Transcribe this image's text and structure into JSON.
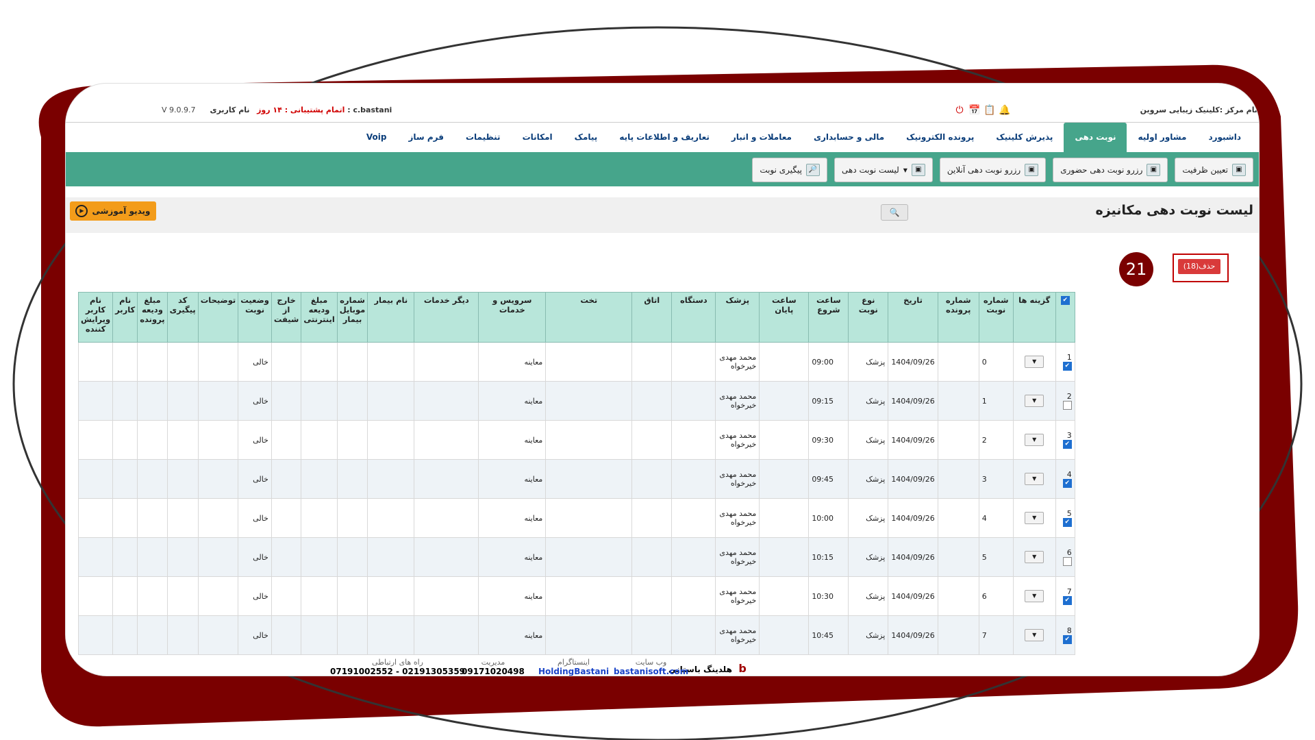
{
  "header": {
    "center_name": "نام مرکز :کلینیک زیبایی سروین",
    "user_label": "نام کاربری : c.bastani",
    "support_label": "اتمام پشتیبانی : ۱۴ روز",
    "version": "V 9.0.9.7"
  },
  "main_nav": {
    "items": [
      {
        "label": "داشبورد"
      },
      {
        "label": "مشاور اولیه"
      },
      {
        "label": "نوبت دهی"
      },
      {
        "label": "پذیرش کلینیک"
      },
      {
        "label": "پرونده الکترونیک"
      },
      {
        "label": "مالی و حسابداری"
      },
      {
        "label": "معاملات و انبار"
      },
      {
        "label": "تعاریف و اطلاعات پایه"
      },
      {
        "label": "پیامک"
      },
      {
        "label": "امکانات"
      },
      {
        "label": "تنظیمات"
      },
      {
        "label": "فرم ساز"
      },
      {
        "label": "Voip"
      }
    ],
    "active_index": 2
  },
  "sub_nav": {
    "items": [
      {
        "label": "تعیین ظرفیت"
      },
      {
        "label": "رزرو نوبت دهی حضوری"
      },
      {
        "label": "رزرو نوبت دهی آنلاین"
      },
      {
        "label": "لیست نوبت دهی"
      },
      {
        "label": "پیگیری نوبت"
      }
    ]
  },
  "page": {
    "title": "لیست نوبت دهی مکانیزه",
    "video_label": "ویدیو آموزشی",
    "badge": "21",
    "delete_label": "حذف(18)"
  },
  "table": {
    "headers": [
      "",
      "گزینه ها",
      "شماره نوبت",
      "شماره پرونده",
      "تاریخ",
      "نوع نوبت",
      "ساعت شروع",
      "ساعت پایان",
      "پزشک",
      "دستگاه",
      "اتاق",
      "تخت",
      "سرویس و خدمات",
      "دیگر خدمات",
      "نام بیمار",
      "شماره موبایل بیمار",
      "مبلغ ودیعه اینترنتی",
      "خارج از شیفت",
      "وضعیت نوبت",
      "توضیحات",
      "کد پیگیری",
      "مبلغ ودیعه پرونده",
      "نام کاربر",
      "نام کاربر ویرایش کننده"
    ],
    "rows": [
      {
        "idx": "1",
        "checked": true,
        "no": "0",
        "date": "1404/09/26",
        "type": "پزشک",
        "start": "09:00",
        "doctor": "محمد مهدی خیرخواه",
        "service": "معاینه",
        "status": "خالی"
      },
      {
        "idx": "2",
        "checked": false,
        "no": "1",
        "date": "1404/09/26",
        "type": "پزشک",
        "start": "09:15",
        "doctor": "محمد مهدی خیرخواه",
        "service": "معاینه",
        "status": "خالی"
      },
      {
        "idx": "3",
        "checked": true,
        "no": "2",
        "date": "1404/09/26",
        "type": "پزشک",
        "start": "09:30",
        "doctor": "محمد مهدی خیرخواه",
        "service": "معاینه",
        "status": "خالی"
      },
      {
        "idx": "4",
        "checked": true,
        "no": "3",
        "date": "1404/09/26",
        "type": "پزشک",
        "start": "09:45",
        "doctor": "محمد مهدی خیرخواه",
        "service": "معاینه",
        "status": "خالی"
      },
      {
        "idx": "5",
        "checked": true,
        "no": "4",
        "date": "1404/09/26",
        "type": "پزشک",
        "start": "10:00",
        "doctor": "محمد مهدی خیرخواه",
        "service": "معاینه",
        "status": "خالی"
      },
      {
        "idx": "6",
        "checked": false,
        "no": "5",
        "date": "1404/09/26",
        "type": "پزشک",
        "start": "10:15",
        "doctor": "محمد مهدی خیرخواه",
        "service": "معاینه",
        "status": "خالی"
      },
      {
        "idx": "7",
        "checked": true,
        "no": "6",
        "date": "1404/09/26",
        "type": "پزشک",
        "start": "10:30",
        "doctor": "محمد مهدی خیرخواه",
        "service": "معاینه",
        "status": "خالی"
      },
      {
        "idx": "8",
        "checked": true,
        "no": "7",
        "date": "1404/09/26",
        "type": "پزشک",
        "start": "10:45",
        "doctor": "محمد مهدی خیرخواه",
        "service": "معاینه",
        "status": "خالی"
      }
    ]
  },
  "footer": {
    "brand": "هلدینگ باستانی",
    "website_label": "وب سایت",
    "website": "bastanisoft.com",
    "instagram_label": "اینستاگرام",
    "instagram": "HoldingBastani",
    "management_label": "مدیریت",
    "management": "09171020498",
    "contact_label": "راه های ارتباطی",
    "contact": "07191002552 - 02191305359"
  },
  "colors": {
    "accent": "#46a58b",
    "frame": "#7a0000",
    "header_bg": "#b8e6da"
  }
}
